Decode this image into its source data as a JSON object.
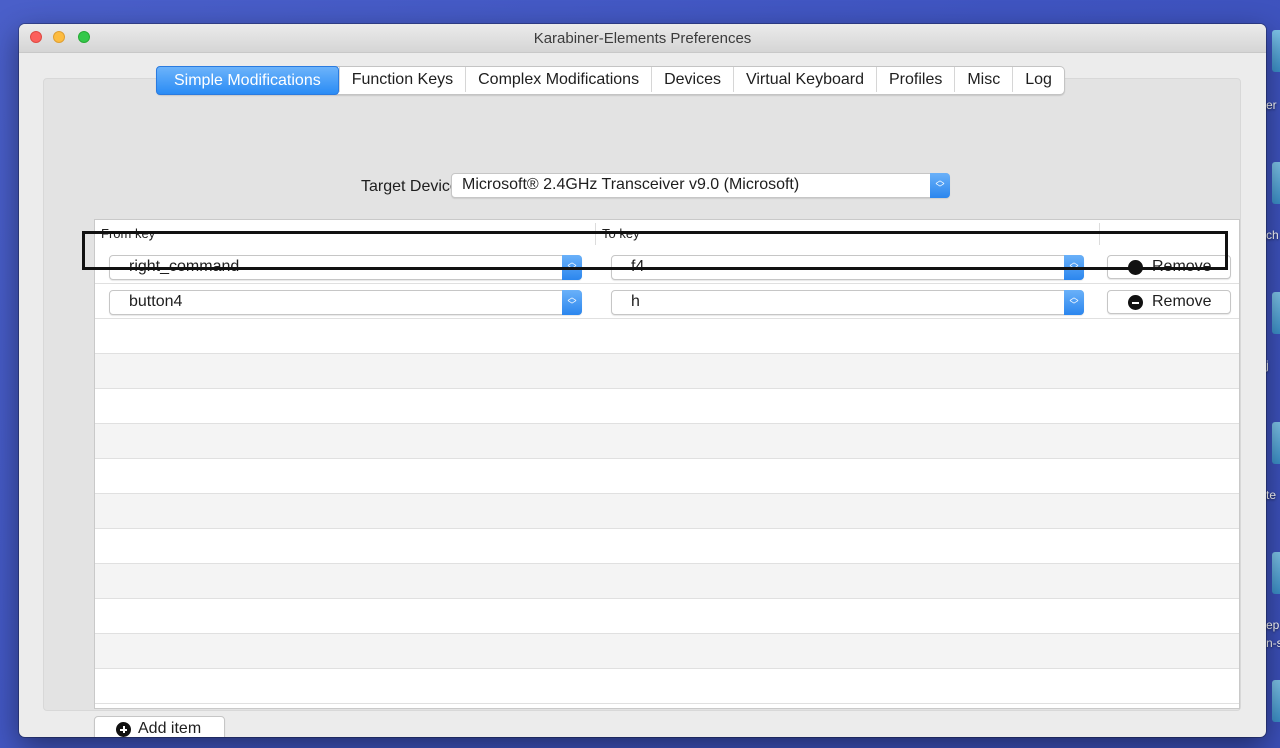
{
  "window": {
    "title": "Karabiner-Elements Preferences"
  },
  "tabs": [
    {
      "label": "Simple Modifications",
      "active": true
    },
    {
      "label": "Function Keys",
      "active": false
    },
    {
      "label": "Complex Modifications",
      "active": false
    },
    {
      "label": "Devices",
      "active": false
    },
    {
      "label": "Virtual Keyboard",
      "active": false
    },
    {
      "label": "Profiles",
      "active": false
    },
    {
      "label": "Misc",
      "active": false
    },
    {
      "label": "Log",
      "active": false
    }
  ],
  "target_device": {
    "label": "Target Device:",
    "value": "Microsoft® 2.4GHz Transceiver v9.0 (Microsoft)"
  },
  "table": {
    "columns": {
      "from": "From key",
      "to": "To key"
    },
    "rows": [
      {
        "from": "right_command",
        "to": "f4",
        "remove_label": "Remove"
      },
      {
        "from": "button4",
        "to": "h",
        "remove_label": "Remove",
        "highlighted": true
      }
    ]
  },
  "footer": {
    "add_label": "Add item"
  },
  "desktop": {
    "labels": [
      "er",
      "ch",
      "j",
      "te",
      "ep",
      "n-s"
    ]
  },
  "colors": {
    "accent": "#2a8cf5",
    "highlight_border": "#111111"
  }
}
